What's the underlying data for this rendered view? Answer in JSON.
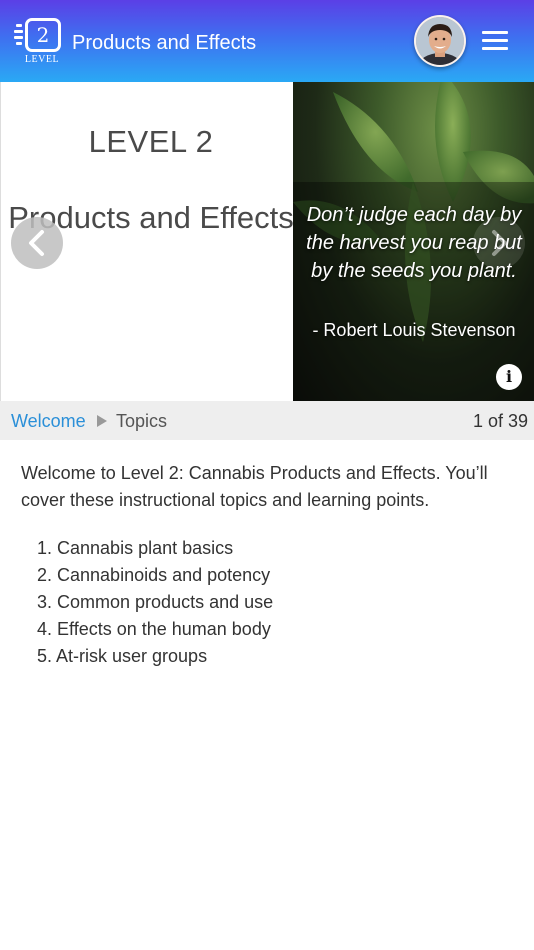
{
  "header": {
    "badge_number": "2",
    "badge_word": "LEVEL",
    "title": "Products and Effects",
    "menu_icon": "hamburger-menu-icon",
    "avatar_icon": "user-avatar"
  },
  "slide": {
    "level_heading": "LEVEL 2",
    "subtitle": "Products and Effects",
    "quote": "Don’t judge each day by the harvest you reap but by the seeds you plant.",
    "quote_author": "- Robert Louis Stevenson",
    "info_label": "i",
    "prev_icon": "chevron-left-icon",
    "next_icon": "chevron-right-icon"
  },
  "breadcrumb": {
    "items": [
      "Welcome",
      "Topics"
    ],
    "separator_icon": "triangle-right-icon",
    "counter": "1 of 39"
  },
  "content": {
    "intro": "Welcome to Level 2: Cannabis Products and Effects. You’ll cover these instructional topics and learning points.",
    "topics": [
      {
        "number": "1.",
        "label": "Cannabis plant basics"
      },
      {
        "number": "2.",
        "label": "Cannabinoids and potency"
      },
      {
        "number": "3.",
        "label": "Common products and use"
      },
      {
        "number": "4.",
        "label": "Effects on the human body"
      },
      {
        "number": "5.",
        "label": "At-risk user groups"
      }
    ]
  },
  "colors": {
    "header_gradient_top": "#5b3fe6",
    "header_gradient_bottom": "#2aa9f5",
    "link": "#2a8fd8",
    "breadcrumb_bg": "#eeeeee"
  }
}
